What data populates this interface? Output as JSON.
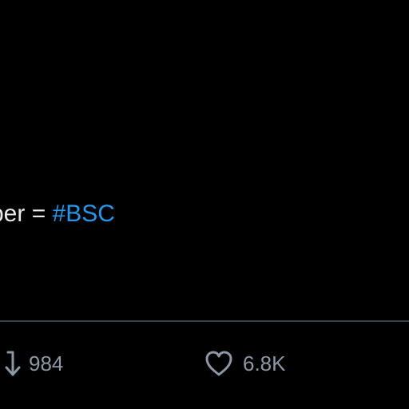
{
  "tweet": {
    "text_prefix": "ber = ",
    "hashtag": "#BSC"
  },
  "actions": {
    "retweet": {
      "icon": "retweet-icon",
      "count": "984"
    },
    "like": {
      "icon": "heart-icon",
      "count": "6.8K"
    }
  },
  "colors": {
    "background": "#000000",
    "text": "#e7e9ea",
    "hashtag": "#1d9bf0",
    "muted": "#8b98a5",
    "divider": "#38444d"
  }
}
